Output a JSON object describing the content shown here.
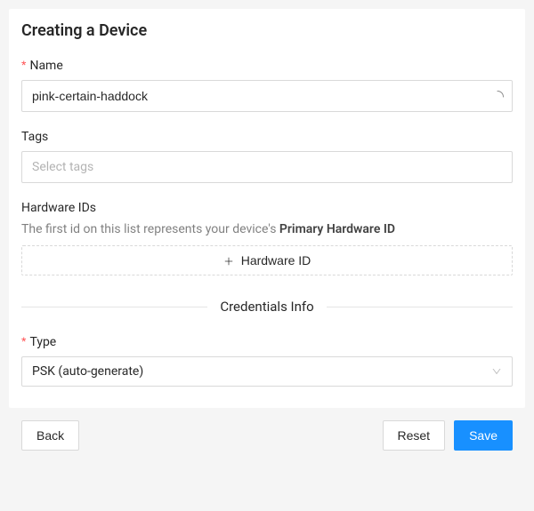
{
  "title": "Creating a Device",
  "fields": {
    "name": {
      "label": "Name",
      "value": "pink-certain-haddock",
      "required": true
    },
    "tags": {
      "label": "Tags",
      "placeholder": "Select tags"
    },
    "hardware_ids": {
      "label": "Hardware IDs",
      "help_prefix": "The first id on this list represents your device's ",
      "help_bold": "Primary Hardware ID",
      "add_button": "Hardware ID"
    },
    "type": {
      "label": "Type",
      "value": "PSK (auto-generate)",
      "required": true
    }
  },
  "divider": "Credentials Info",
  "buttons": {
    "back": "Back",
    "reset": "Reset",
    "save": "Save"
  },
  "required_mark": "*"
}
